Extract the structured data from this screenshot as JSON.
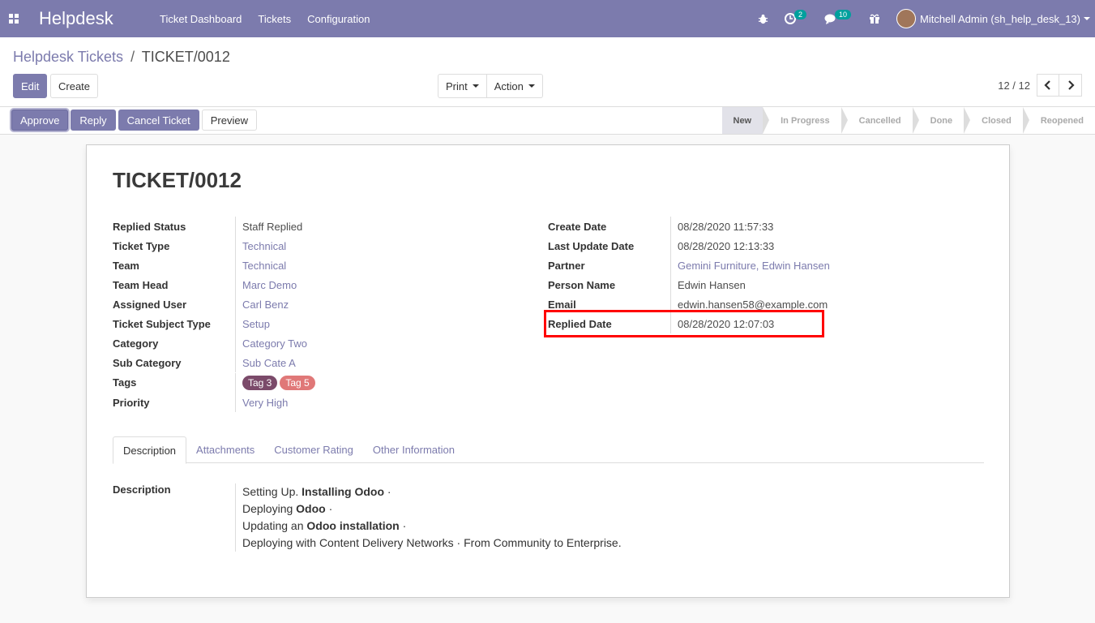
{
  "navbar": {
    "brand": "Helpdesk",
    "menu": [
      "Ticket Dashboard",
      "Tickets",
      "Configuration"
    ],
    "activity_badge": "2",
    "messages_badge": "10",
    "user": "Mitchell Admin (sh_help_desk_13)"
  },
  "breadcrumb": {
    "parent": "Helpdesk Tickets",
    "separator": "/",
    "current": "TICKET/0012"
  },
  "buttons": {
    "edit": "Edit",
    "create": "Create",
    "print": "Print",
    "action": "Action"
  },
  "pager": {
    "value": "12 / 12",
    "prev": "‹",
    "next": "›"
  },
  "status_buttons": {
    "approve": "Approve",
    "reply": "Reply",
    "cancel": "Cancel Ticket",
    "preview": "Preview"
  },
  "stages": [
    "New",
    "In Progress",
    "Cancelled",
    "Done",
    "Closed",
    "Reopened"
  ],
  "active_stage": "New",
  "ticket": {
    "title": "TICKET/0012",
    "left_fields": [
      {
        "label": "Replied Status",
        "value": "Staff Replied"
      },
      {
        "label": "Ticket Type",
        "value": "Technical"
      },
      {
        "label": "Team",
        "value": "Technical"
      },
      {
        "label": "Team Head",
        "value": "Marc Demo"
      },
      {
        "label": "Assigned User",
        "value": "Carl Benz"
      },
      {
        "label": "Ticket Subject Type",
        "value": "Setup"
      },
      {
        "label": "Category",
        "value": "Category Two"
      },
      {
        "label": "Sub Category",
        "value": "Sub Cate A"
      },
      {
        "label": "Tags",
        "value": ""
      },
      {
        "label": "Priority",
        "value": "Very High"
      }
    ],
    "tags": [
      {
        "label": "Tag 3",
        "color": "#7b4a6a"
      },
      {
        "label": "Tag 5",
        "color": "#e07878"
      }
    ],
    "right_fields": [
      {
        "label": "Create Date",
        "value": "08/28/2020 11:57:33"
      },
      {
        "label": "Last Update Date",
        "value": "08/28/2020 12:13:33"
      },
      {
        "label": "Partner",
        "value": "Gemini Furniture, Edwin Hansen"
      },
      {
        "label": "Person Name",
        "value": "Edwin Hansen"
      },
      {
        "label": "Email",
        "value": "edwin.hansen58@example.com"
      },
      {
        "label": "Replied Date",
        "value": "08/28/2020 12:07:03"
      }
    ]
  },
  "tabs": [
    "Description",
    "Attachments",
    "Customer Rating",
    "Other Information"
  ],
  "description": {
    "label": "Description",
    "line1_a": "Setting Up. ",
    "line1_b": "Installing Odoo",
    "line1_c": " ·",
    "line2_a": "Deploying ",
    "line2_b": "Odoo",
    "line2_c": " ·",
    "line3_a": "Updating an ",
    "line3_b": "Odoo installation",
    "line3_c": " ·",
    "line4": "Deploying with Content Delivery Networks · From Community to Enterprise."
  },
  "colors": {
    "brand": "#7c7bad",
    "highlight": "#ff0000"
  }
}
